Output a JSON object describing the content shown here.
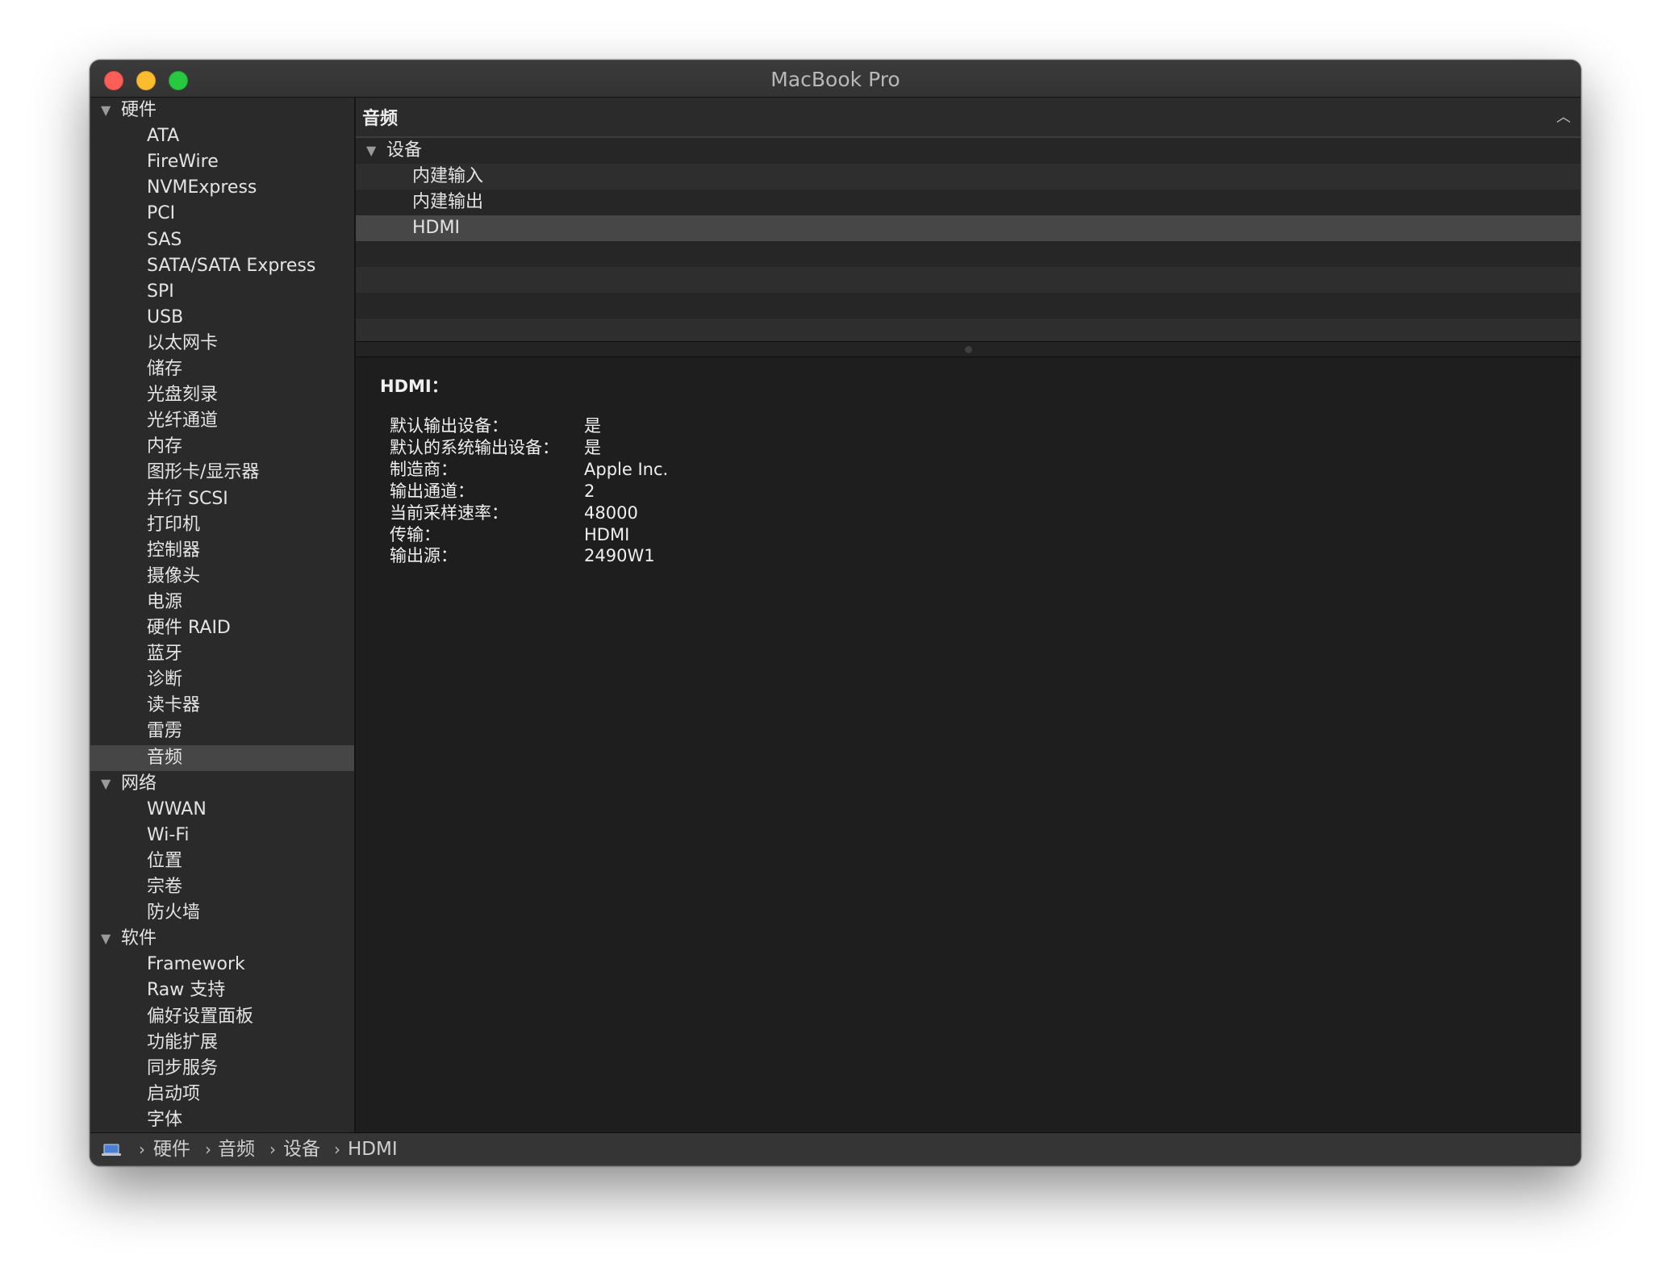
{
  "window": {
    "title": "MacBook Pro"
  },
  "sidebar": {
    "groups": [
      {
        "label": "硬件",
        "items": [
          "ATA",
          "FireWire",
          "NVMExpress",
          "PCI",
          "SAS",
          "SATA/SATA Express",
          "SPI",
          "USB",
          "以太网卡",
          "储存",
          "光盘刻录",
          "光纤通道",
          "内存",
          "图形卡/显示器",
          "并行 SCSI",
          "打印机",
          "控制器",
          "摄像头",
          "电源",
          "硬件 RAID",
          "蓝牙",
          "诊断",
          "读卡器",
          "雷雳",
          "音频"
        ]
      },
      {
        "label": "网络",
        "items": [
          "WWAN",
          "Wi-Fi",
          "位置",
          "宗卷",
          "防火墙"
        ]
      },
      {
        "label": "软件",
        "items": [
          "Framework",
          "Raw 支持",
          "偏好设置面板",
          "功能扩展",
          "同步服务",
          "启动项",
          "字体"
        ]
      }
    ],
    "selected": "音频"
  },
  "table": {
    "column_header": "音频",
    "group_label": "设备",
    "rows": [
      "内建输入",
      "内建输出",
      "HDMI"
    ],
    "selected": "HDMI"
  },
  "detail": {
    "title": "HDMI：",
    "properties": [
      {
        "key": "默认输出设备：",
        "value": "是"
      },
      {
        "key": "默认的系统输出设备：",
        "value": "是"
      },
      {
        "key": "制造商：",
        "value": "Apple Inc."
      },
      {
        "key": "输出通道：",
        "value": "2"
      },
      {
        "key": "当前采样速率：",
        "value": "48000"
      },
      {
        "key": "传输：",
        "value": "HDMI"
      },
      {
        "key": "输出源：",
        "value": "2490W1"
      }
    ]
  },
  "pathbar": {
    "icon": "macbook-icon",
    "crumbs": [
      "硬件",
      "音频",
      "设备",
      "HDMI"
    ]
  }
}
